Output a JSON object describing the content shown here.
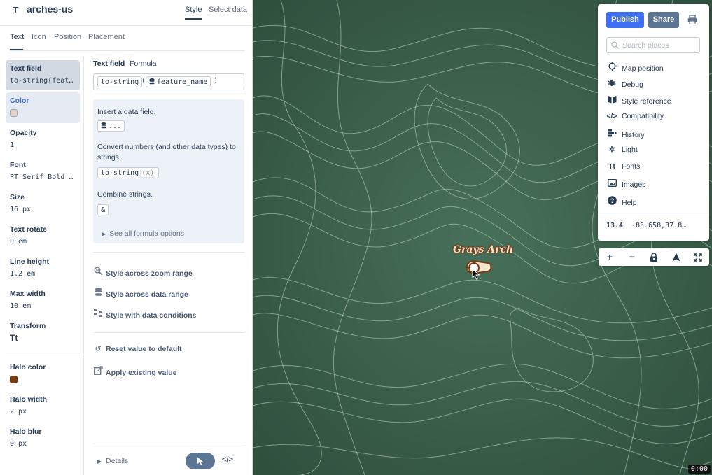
{
  "header": {
    "layer_type_icon": "T",
    "layer_name": "arches-us",
    "tab_style": "Style",
    "tab_select_data": "Select data"
  },
  "subtabs": [
    "Text",
    "Icon",
    "Position",
    "Placement"
  ],
  "properties": [
    {
      "label": "Text field",
      "value": "to-string(feature_name)"
    },
    {
      "label": "Color",
      "swatch": "#e2d2c8"
    },
    {
      "label": "Opacity",
      "value": "1"
    },
    {
      "label": "Font",
      "value": "PT Serif Bold Italic"
    },
    {
      "label": "Size",
      "value": "16 px"
    },
    {
      "label": "Text rotate",
      "value": "0 em"
    },
    {
      "label": "Line height",
      "value": "1.2 em"
    },
    {
      "label": "Max width",
      "value": "10 em"
    },
    {
      "label": "Transform",
      "icon": "text-transform-icon",
      "glyph": "Tt"
    },
    {
      "label": "Halo color",
      "swatch": "#7a3d12"
    },
    {
      "label": "Halo width",
      "value": "2 px"
    },
    {
      "label": "Halo blur",
      "value": "0 px"
    }
  ],
  "editor": {
    "label": "Text field",
    "mode": "Formula",
    "formula": {
      "fn": "to-string",
      "open": "(",
      "field": "feature_name",
      "close": ")"
    },
    "hints": {
      "insert_label": "Insert a data field.",
      "insert_chip": "...",
      "convert_label": "Convert numbers (and other data types) to strings.",
      "convert_chip_fn": "to-string",
      "convert_chip_arg": "(x)",
      "combine_label": "Combine strings.",
      "combine_chip": "&",
      "see_all": "See all formula options"
    },
    "actions": {
      "zoom_range": "Style across zoom range",
      "data_range": "Style across data range",
      "data_conditions": "Style with data conditions",
      "reset": "Reset value to default",
      "apply_existing": "Apply existing value"
    },
    "footer": {
      "details": "Details",
      "code": "</>"
    }
  },
  "map": {
    "label": "Grays Arch",
    "attribution": "0:00"
  },
  "menu": {
    "publish": "Publish",
    "share": "Share",
    "search_placeholder": "Search places",
    "items": [
      {
        "label": "Map position",
        "icon": "crosshair-icon"
      },
      {
        "label": "Debug",
        "icon": "bug-icon"
      },
      {
        "label": "Style reference",
        "icon": "book-icon"
      },
      {
        "label": "Compatibility",
        "icon": "code-icon"
      },
      {
        "label": "History",
        "icon": "history-icon"
      },
      {
        "label": "Light",
        "icon": "sun-icon"
      },
      {
        "label": "Fonts",
        "icon": "fonts-icon"
      },
      {
        "label": "Images",
        "icon": "image-icon"
      },
      {
        "label": "Help",
        "icon": "help-icon"
      }
    ],
    "zoom": "13.4",
    "coords": "-83.658,37.8…"
  },
  "map_controls": [
    "+",
    "−",
    "lock-icon",
    "compass-icon",
    "fullscreen-icon"
  ]
}
